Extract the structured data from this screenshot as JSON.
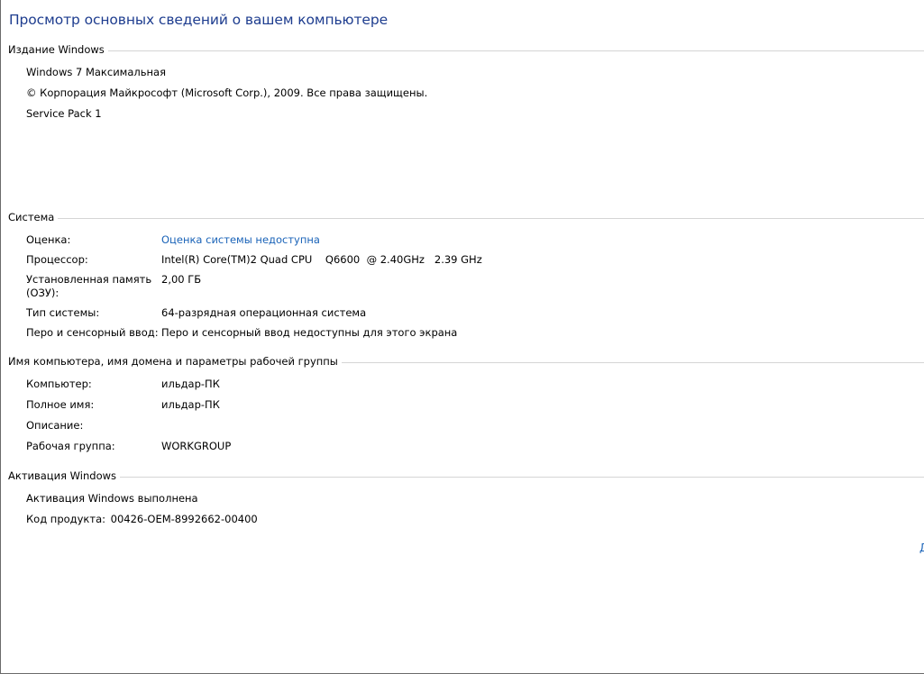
{
  "page_title": "Просмотр основных сведений о вашем компьютере",
  "windows_edition": {
    "header": "Издание Windows",
    "edition": "Windows 7 Максимальная",
    "copyright": "© Корпорация Майкрософт (Microsoft Corp.), 2009. Все права защищены.",
    "service_pack": "Service Pack 1"
  },
  "system": {
    "header": "Система",
    "rating_label": "Оценка:",
    "rating_value": "Оценка системы недоступна",
    "processor_label": "Процессор:",
    "processor_value": "Intel(R) Core(TM)2 Quad CPU    Q6600  @ 2.40GHz   2.39 GHz",
    "ram_label_line1": "Установленная память",
    "ram_label_line2": "(ОЗУ):",
    "ram_value": "2,00 ГБ",
    "type_label": "Тип системы:",
    "type_value": "64-разрядная операционная система",
    "pen_label": "Перо и сенсорный ввод:",
    "pen_value": "Перо и сенсорный ввод недоступны для этого экрана"
  },
  "computer_name": {
    "header": "Имя компьютера, имя домена и параметры рабочей группы",
    "computer_label": "Компьютер:",
    "computer_value": "ильдар-ПК",
    "fullname_label": "Полное имя:",
    "fullname_value": "ильдар-ПК",
    "description_label": "Описание:",
    "description_value": "",
    "workgroup_label": "Рабочая группа:",
    "workgroup_value": "WORKGROUP"
  },
  "activation": {
    "header": "Активация Windows",
    "status": "Активация Windows выполнена",
    "product_key_label": "Код продукта:",
    "product_key_value": "00426-OEM-8992662-00400"
  },
  "edge_link_text": "Д",
  "colors": {
    "title": "#1e3d8f",
    "link": "#1a63b8",
    "rule": "#d5d5d5"
  }
}
